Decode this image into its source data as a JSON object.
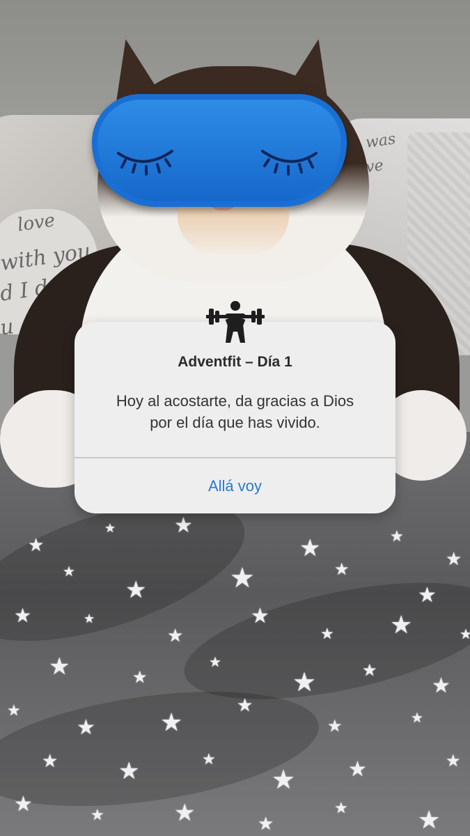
{
  "dialog": {
    "title": "Adventfit – Día 1",
    "message": "Hoy al acostarte, da gracias a Dios\npor el día que has vivido.",
    "button_label": "Allá voy"
  },
  "icons": {
    "app_icon": "weightlifter-icon"
  },
  "background": {
    "pillow_text": [
      "love",
      "with you",
      "d I d",
      "u a lo"
    ],
    "pillow_right_text": [
      "was",
      "love"
    ]
  },
  "colors": {
    "accent": "#2a7ad1",
    "dialog_bg": "#eeeeef",
    "mask": "#1f78dd"
  }
}
